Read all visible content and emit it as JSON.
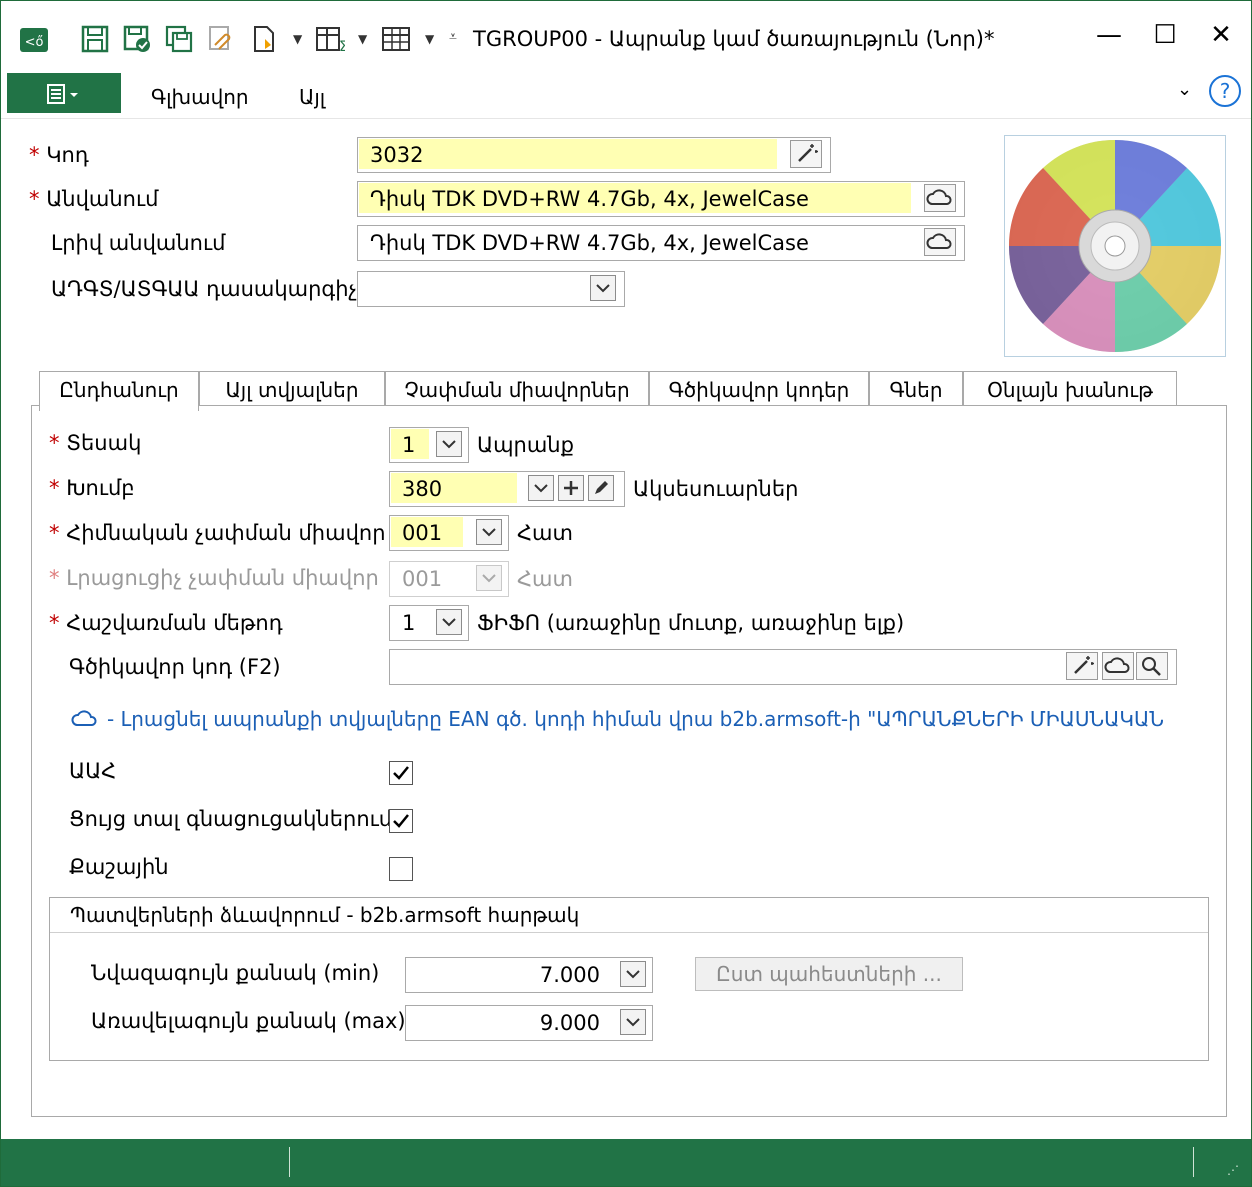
{
  "title": "TGROUP00 - Ապրանք կամ ծառայություն (Նոր)*",
  "toolbar": {
    "icons": [
      "app-icon",
      "save-icon",
      "save-close-icon",
      "save-copy-icon",
      "attach-icon",
      "new-doc-icon",
      "columns-icon",
      "table-icon",
      "quick-access-icon"
    ]
  },
  "window_buttons": {
    "minimize": "—",
    "maximize": "☐",
    "close": "✕"
  },
  "ribbon": {
    "tabs": [
      "Գլխավոր",
      "Այլ"
    ],
    "help": "?"
  },
  "header_fields": {
    "code": {
      "label": "Կոդ",
      "value": "3032"
    },
    "name": {
      "label": "Անվանում",
      "value": "Դիսկ TDK DVD+RW 4.7Gb, 4x, JewelCase"
    },
    "full_name": {
      "label": "Լրիվ անվանում",
      "value": "Դիսկ TDK DVD+RW 4.7Gb, 4x, JewelCase"
    },
    "classifier": {
      "label": "ԱԴԳՏ/ԱՏԳԱԱ դասակարգիչ",
      "value": ""
    }
  },
  "tabs": [
    "Ընդհանուր",
    "Այլ տվյալներ",
    "Չափման միավորներ",
    "Գծիկավոր կոդեր",
    "Գներ",
    "Օնլայն խանութ"
  ],
  "general": {
    "type": {
      "label": "Տեսակ",
      "value": "1",
      "text": "Ապրանք"
    },
    "group": {
      "label": "Խումբ",
      "value": "380",
      "text": "Ակսեսուարներ"
    },
    "base_unit": {
      "label": "Հիմնական չափման միավոր",
      "value": "001",
      "text": "Հատ"
    },
    "extra_unit": {
      "label": "Լրացուցիչ չափման միավոր",
      "value": "001",
      "text": "Հատ"
    },
    "method": {
      "label": "Հաշվառման մեթոդ",
      "value": "1",
      "text": "ՖԻՖՈ (առաջինը մուտք, առաջինը ելք)"
    },
    "barcode": {
      "label": "Գծիկավոր կոդ (F2)",
      "value": ""
    },
    "info_link": "- Լրացնել ապրանքի տվյալները EAN գծ. կոդի հիման վրա b2b.armsoft-ի \"ԱՊՐԱՆՔՆԵՐԻ ՄԻԱՍՆԱԿԱՆ",
    "vat": {
      "label": "ԱԱՀ",
      "checked": true
    },
    "show_in_pricelists": {
      "label": "Ցույց տալ գնացուցակներում",
      "checked": true
    },
    "by_weight": {
      "label": "Քաշային",
      "checked": false
    }
  },
  "orders_group": {
    "title": "Պատվերների ձևավորում - b2b.armsoft հարթակ",
    "min_qty": {
      "label": "Նվազագույն քանակ (min)",
      "value": "7.000"
    },
    "max_qty": {
      "label": "Առավելագույն քանակ (max)",
      "value": "9.000"
    },
    "by_warehouses_button": "Ըստ պահեստների ..."
  },
  "colors": {
    "accent": "#217346",
    "required": "#c00000",
    "highlight": "#ffffb3",
    "link": "#1b5fb5"
  }
}
